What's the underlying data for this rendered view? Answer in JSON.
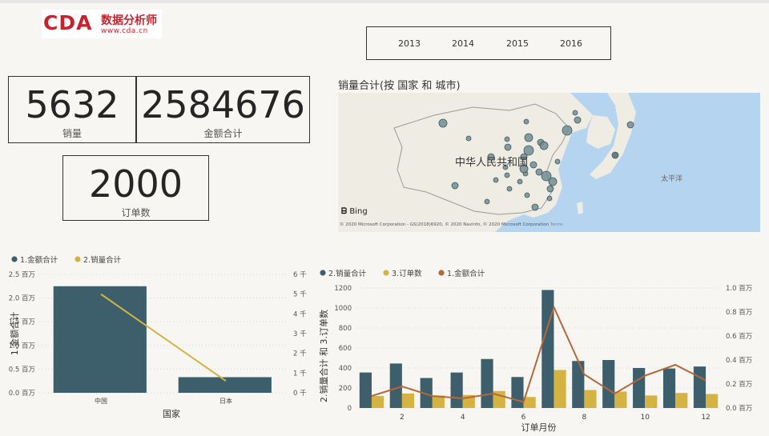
{
  "logo": {
    "mark": "CDA",
    "cn": "数据分析师",
    "url": "www.cda.cn"
  },
  "slicer": {
    "years": [
      "2013",
      "2014",
      "2015",
      "2016"
    ]
  },
  "cards": {
    "sales": {
      "value": "5632",
      "label": "销量"
    },
    "amount": {
      "value": "2584676",
      "label": "金额合计"
    },
    "orders": {
      "value": "2000",
      "label": "订单数"
    }
  },
  "map": {
    "title": "销量合计(按 国家 和 城市)",
    "country_label": "中华人民共和国",
    "ocean_label": "太平洋",
    "bing": "Bing",
    "copyright": "© 2020 Microsoft Corporation - GS(2018)6920, © 2020 Navinfo, © 2020 Microsoft Corporation",
    "terms": "Terms",
    "colors": {
      "land": "#efece4",
      "water": "#b5d4ef",
      "bubble": "#6f8e93"
    }
  },
  "chart_data": [
    {
      "type": "bar",
      "legend": [
        "1.金额合计",
        "2.销量合计"
      ],
      "legend_placement": "top-left",
      "categories": [
        "中国",
        "日本"
      ],
      "series": [
        {
          "name": "1.金额合计",
          "type": "bar",
          "axis": "left",
          "values": [
            2250000,
            330000
          ],
          "color": "#3d5f6b"
        },
        {
          "name": "2.销量合计",
          "type": "line",
          "axis": "right",
          "values": [
            5000,
            600
          ],
          "color": "#d4b342"
        }
      ],
      "xlabel": "国家",
      "ylabel": "1.金额合计",
      "ylim": [
        0,
        2500000
      ],
      "y_ticks": [
        "0.0 百万",
        "0.5 百万",
        "1.0 百万",
        "1.5 百万",
        "2.0 百万",
        "2.5 百万"
      ],
      "y2lim": [
        0,
        6000
      ],
      "y2_ticks": [
        "0 千",
        "1 千",
        "2 千",
        "3 千",
        "4 千",
        "5 千",
        "6 千"
      ],
      "grid": true
    },
    {
      "type": "bar",
      "legend": [
        "2.销量合计",
        "3.订单数",
        "1.金额合计"
      ],
      "legend_placement": "top-left",
      "categories": [
        1,
        2,
        3,
        4,
        5,
        6,
        7,
        8,
        9,
        10,
        11,
        12
      ],
      "x_ticks": [
        "2",
        "4",
        "6",
        "8",
        "10",
        "12"
      ],
      "series": [
        {
          "name": "2.销量合计",
          "type": "bar",
          "axis": "left",
          "values": [
            355,
            445,
            300,
            355,
            490,
            310,
            1180,
            470,
            480,
            400,
            395,
            415
          ],
          "color": "#3d5f6b"
        },
        {
          "name": "3.订单数",
          "type": "bar",
          "axis": "left",
          "values": [
            120,
            145,
            125,
            130,
            170,
            110,
            380,
            180,
            165,
            125,
            150,
            140
          ],
          "color": "#d4b342"
        },
        {
          "name": "1.金额合计",
          "type": "line",
          "axis": "right",
          "values": [
            0.1,
            0.18,
            0.1,
            0.08,
            0.12,
            0.05,
            0.84,
            0.28,
            0.12,
            0.27,
            0.36,
            0.23
          ],
          "color": "#b5673a"
        }
      ],
      "xlabel": "订单月份",
      "ylabel": "2.销量合计 和 3.订单数",
      "ylim": [
        0,
        1200
      ],
      "y_ticks": [
        "0",
        "200",
        "400",
        "600",
        "800",
        "1000",
        "1200"
      ],
      "y2lim": [
        0,
        1.0
      ],
      "y2_ticks": [
        "0.0 百万",
        "0.2 百万",
        "0.4 百万",
        "0.6 百万",
        "0.8 百万",
        "1.0 百万"
      ],
      "grid": true
    }
  ]
}
